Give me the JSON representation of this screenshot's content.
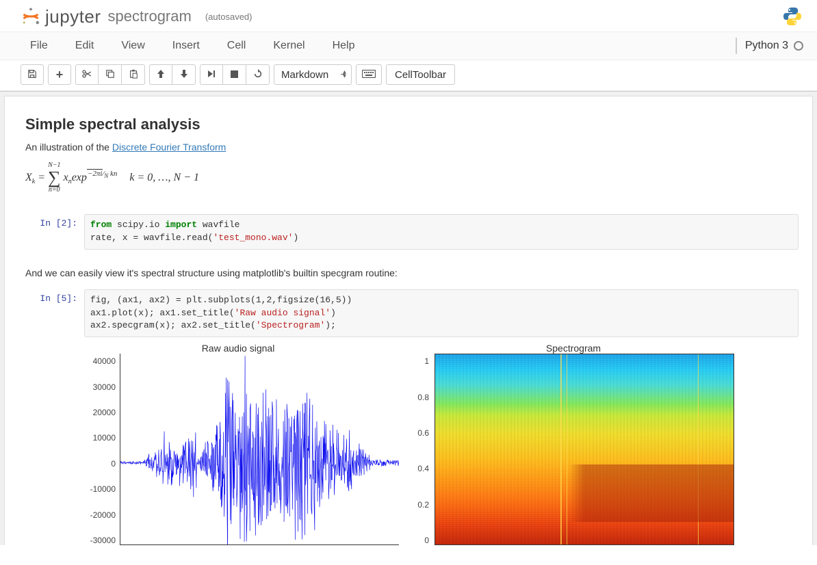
{
  "header": {
    "logo_text": "jupyter",
    "notebook_name": "spectrogram",
    "save_status": "(autosaved)"
  },
  "menubar": {
    "items": [
      "File",
      "Edit",
      "View",
      "Insert",
      "Cell",
      "Kernel",
      "Help"
    ],
    "kernel_name": "Python 3"
  },
  "toolbar": {
    "cell_type": "Markdown",
    "cell_toolbar_label": "CellToolbar"
  },
  "cells": {
    "md1_heading": "Simple spectral analysis",
    "md1_intro": "An illustration of the ",
    "md1_link": "Discrete Fourier Transform",
    "formula_tex": "X_k = \\sum_{n=0}^{N-1} x_n exp^{-(2\\pi i/N)kn}   k = 0, …, N − 1",
    "code1_prompt": "In [2]:",
    "code1_line1_a": "from",
    "code1_line1_b": " scipy.io ",
    "code1_line1_c": "import",
    "code1_line1_d": " wavfile",
    "code1_line2_a": "rate, x = wavfile.read(",
    "code1_line2_b": "'test_mono.wav'",
    "code1_line2_c": ")",
    "md2": "And we can easily view it's spectral structure using matplotlib's builtin specgram routine:",
    "code2_prompt": "In [5]:",
    "code2_line1": "fig, (ax1, ax2) = plt.subplots(1,2,figsize(16,5))",
    "code2_line2_a": "ax1.plot(x); ax1.set_title(",
    "code2_line2_b": "'Raw audio signal'",
    "code2_line2_c": ")",
    "code2_line3_a": "ax2.specgram(x); ax2.set_title(",
    "code2_line3_b": "'Spectrogram'",
    "code2_line3_c": ");"
  },
  "chart_data": [
    {
      "type": "line",
      "title": "Raw audio signal",
      "ylabel": "",
      "xlabel": "",
      "ylim": [
        -30000,
        40000
      ],
      "yticks": [
        40000,
        30000,
        20000,
        10000,
        0,
        -10000,
        -20000,
        -30000
      ],
      "note": "dense audio waveform amplitude vs sample index"
    },
    {
      "type": "heatmap",
      "title": "Spectrogram",
      "ylabel": "",
      "xlabel": "",
      "ylim": [
        0.0,
        1.0
      ],
      "yticks": [
        1.0,
        0.8,
        0.6,
        0.4,
        0.2,
        0.0
      ],
      "note": "time-frequency spectrogram, warm colors at low freq, cool at high freq"
    }
  ]
}
